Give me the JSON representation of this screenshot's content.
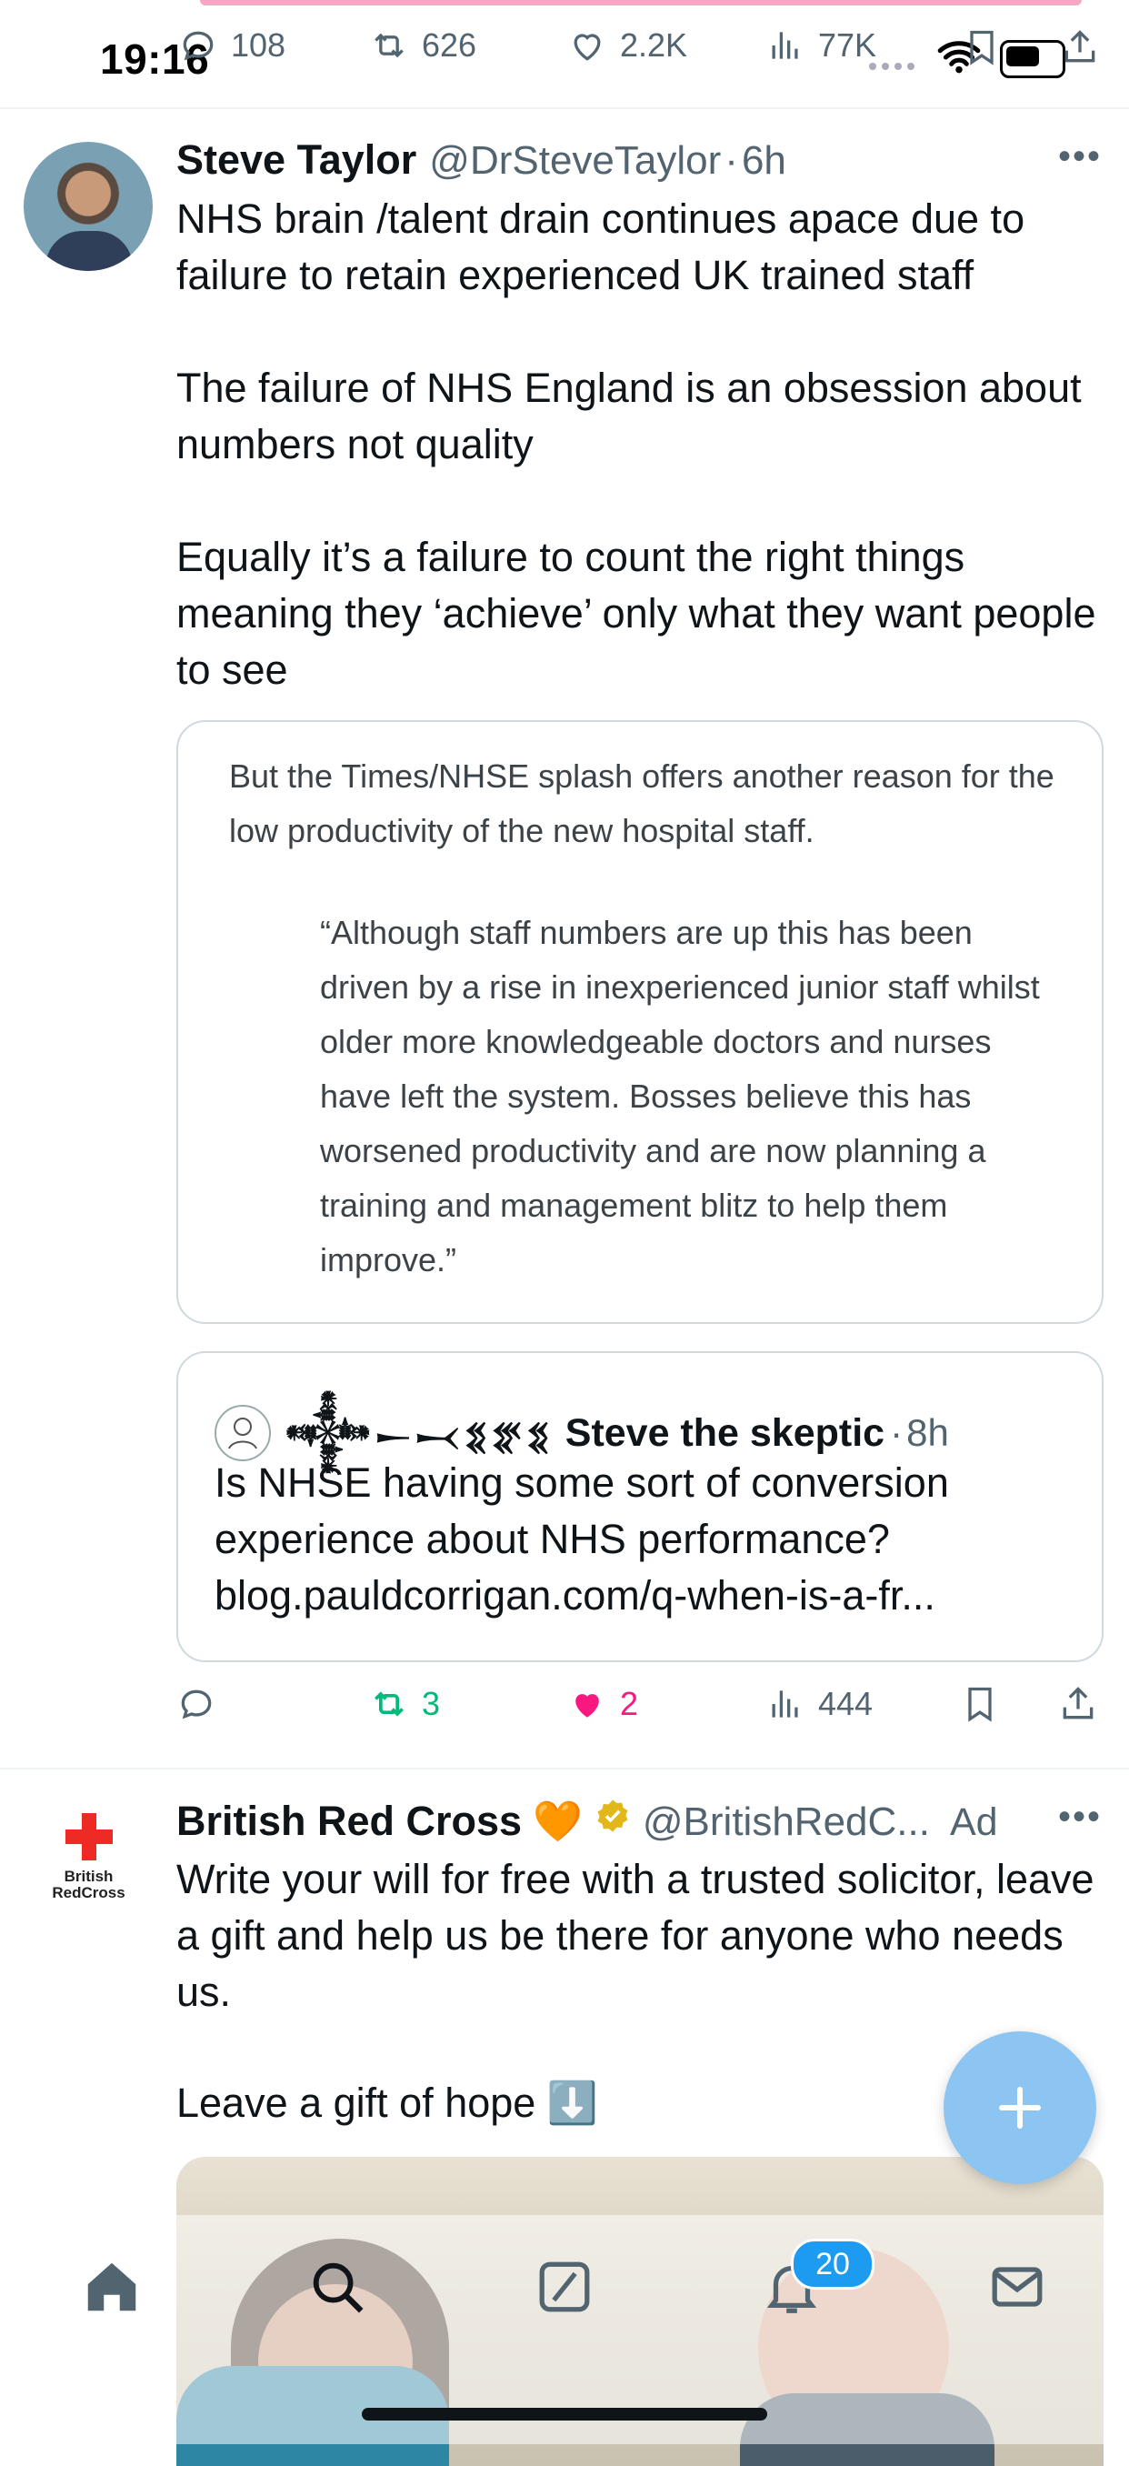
{
  "status_bar": {
    "time": "19:16"
  },
  "prev_tweet_actions": {
    "replies": "108",
    "reposts": "626",
    "likes": "2.2K",
    "views": "77K"
  },
  "tweet": {
    "author_name": "Steve Taylor",
    "author_handle": "@DrSteveTaylor",
    "time": "6h",
    "paragraphs": [
      "NHS brain /talent drain continues apace due to failure to retain experienced UK trained staff",
      "The failure of NHS England is an obsession about numbers not quality",
      "Equally it’s a failure to count the right things meaning they ‘achieve’ only what they want people to see"
    ],
    "quote_image": {
      "intro": "But the Times/NHSE splash offers another reason for the low productivity of the new hospital staff.",
      "indented": "“Although staff numbers are up this has been driven by a rise in inexperienced junior staff whilst older more knowledgeable doctors and nurses have left the system. Bosses believe this has worsened productivity and are now planning a training and management blitz to help them improve.”"
    },
    "quoted_tweet": {
      "name_glyphs": "𒀱𒀸𒁁𒐏𒐐𒐏",
      "name": "Steve the skeptic",
      "time": "8h",
      "text": "Is NHSE having some sort of conversion experience about NHS performance? blog.pauldcorrigan.com/q-when-is-a-fr..."
    },
    "actions": {
      "reposts": "3",
      "likes": "2",
      "views": "444"
    }
  },
  "ad_tweet": {
    "author_name": "British Red Cross",
    "heart_emoji": "🧡",
    "author_handle": "@BritishRedC...",
    "ad_label": "Ad",
    "logo_text_line1": "British",
    "logo_text_line2": "RedCross",
    "paragraph1": "Write your will for free with a trusted solicitor, leave a gift and help us be there for anyone who needs us.",
    "paragraph2": "Leave a gift of hope ⬇️"
  },
  "tab_bar": {
    "notifications_badge": "20"
  },
  "colors": {
    "accent": "#1d9bf0",
    "like": "#f91880",
    "repost": "#00ba7c",
    "fab": "#8cc4f2",
    "brc_red": "#ee2a24"
  },
  "icons": [
    "reply-icon",
    "repost-icon",
    "like-icon",
    "views-icon",
    "bookmark-icon",
    "share-icon",
    "home-icon",
    "search-icon",
    "grok-icon",
    "notifications-icon",
    "messages-icon",
    "compose-icon",
    "verified-icon"
  ]
}
